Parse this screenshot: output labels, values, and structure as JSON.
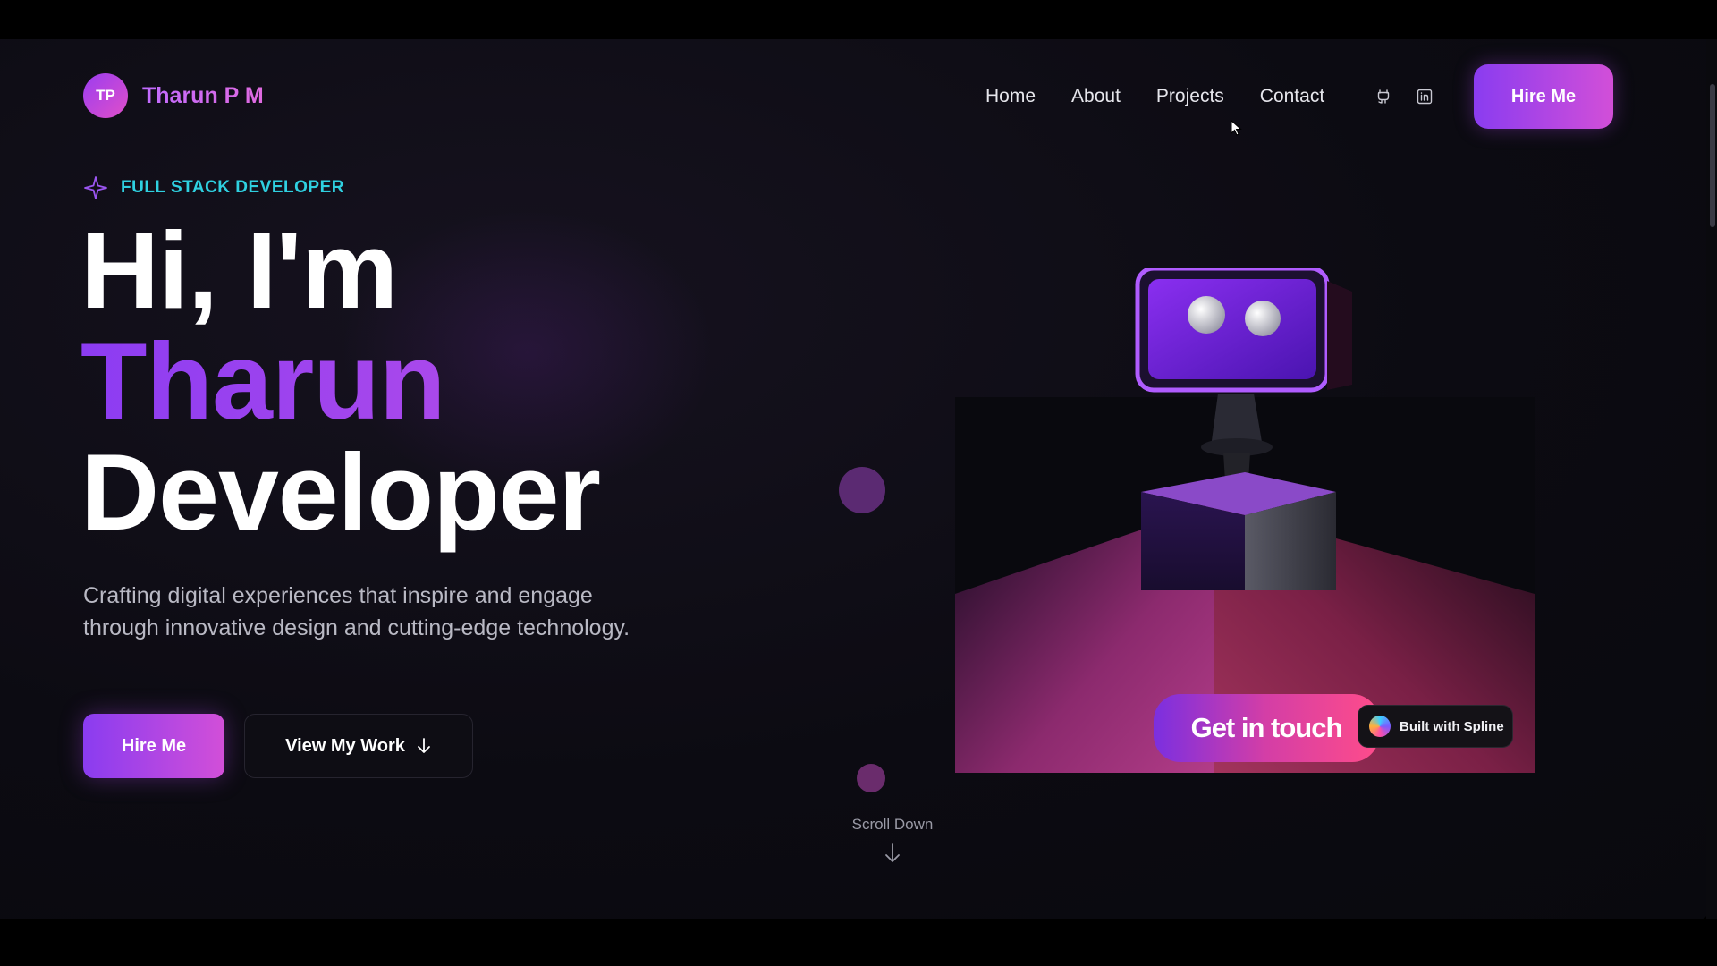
{
  "nav": {
    "logo_initials": "TP",
    "logo_name": "Tharun P M",
    "links": [
      "Home",
      "About",
      "Projects",
      "Contact"
    ],
    "icons": [
      "github-icon",
      "linkedin-icon"
    ],
    "hire_label": "Hire Me"
  },
  "hero": {
    "tagline": "FULL STACK DEVELOPER",
    "line1": "Hi, I'm",
    "line2": "Tharun",
    "line3": "Developer",
    "subtitle": "Crafting digital experiences that inspire and engage through innovative design and cutting-edge technology.",
    "primary_button": "Hire Me",
    "secondary_button": "View My Work",
    "scroll_label": "Scroll Down"
  },
  "scene": {
    "cta_label": "Get in touch",
    "badge_label": "Built with Spline"
  },
  "colors": {
    "accent_purple": "#8a3cf0",
    "accent_pink": "#d24fd8",
    "tagline_cyan": "#2fd0e0",
    "background": "#0c0b12"
  }
}
